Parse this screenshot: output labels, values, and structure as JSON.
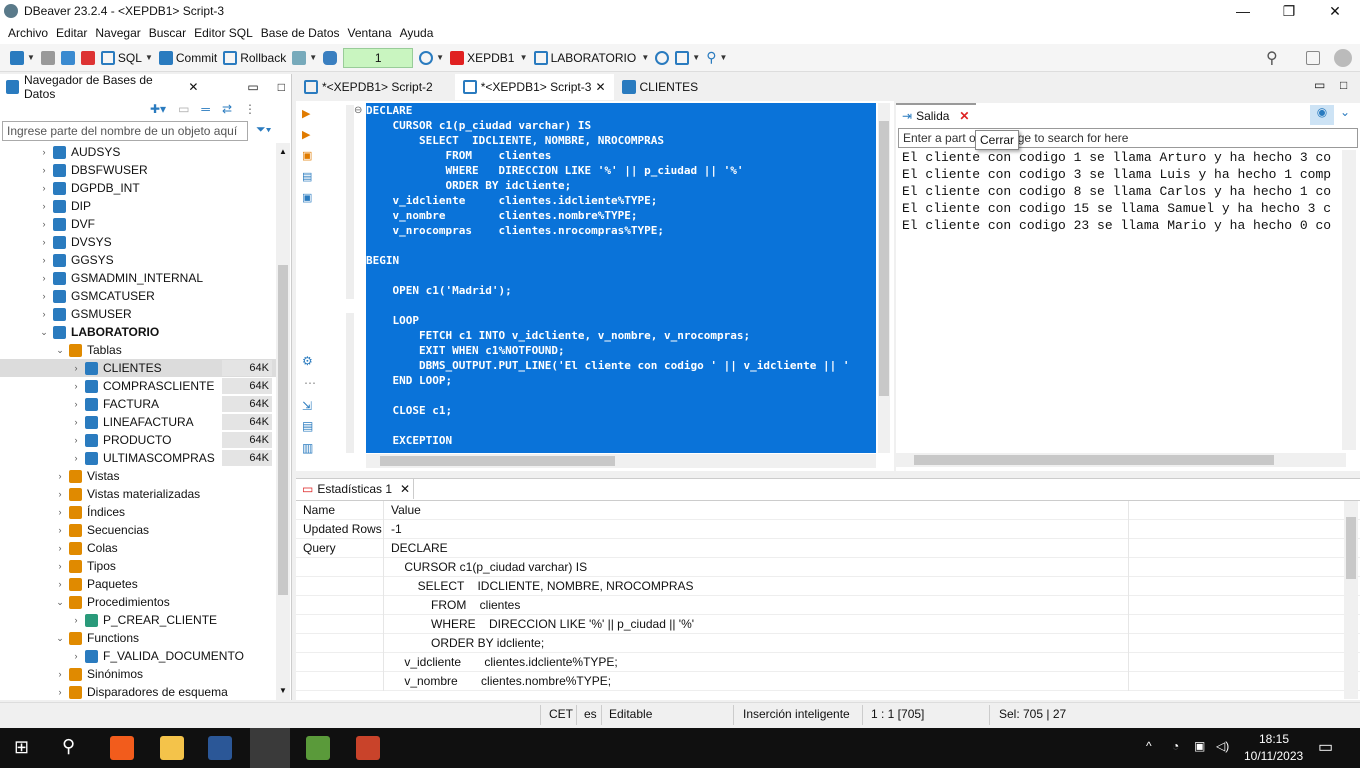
{
  "window": {
    "title": "DBeaver 23.2.4 - <XEPDB1> Script-3",
    "min": "—",
    "max": "❐",
    "close": "✕"
  },
  "menu": [
    "Archivo",
    "Editar",
    "Navegar",
    "Buscar",
    "Editor SQL",
    "Base de Datos",
    "Ventana",
    "Ayuda"
  ],
  "toolbar": {
    "sql": "SQL",
    "commit": "Commit",
    "rollback": "Rollback",
    "txn_count": "1",
    "datasource": "XEPDB1",
    "schema": "LABORATORIO"
  },
  "navigator": {
    "title": "Navegador de Bases de Datos",
    "filter_placeholder": "Ingrese parte del nombre de un objeto aquí",
    "items": [
      {
        "label": "AUDSYS",
        "depth": 1,
        "icon": "schema",
        "exp": ">"
      },
      {
        "label": "DBSFWUSER",
        "depth": 1,
        "icon": "schema",
        "exp": ">"
      },
      {
        "label": "DGPDB_INT",
        "depth": 1,
        "icon": "schema",
        "exp": ">"
      },
      {
        "label": "DIP",
        "depth": 1,
        "icon": "schema",
        "exp": ">"
      },
      {
        "label": "DVF",
        "depth": 1,
        "icon": "schema",
        "exp": ">"
      },
      {
        "label": "DVSYS",
        "depth": 1,
        "icon": "schema",
        "exp": ">"
      },
      {
        "label": "GGSYS",
        "depth": 1,
        "icon": "schema",
        "exp": ">"
      },
      {
        "label": "GSMADMIN_INTERNAL",
        "depth": 1,
        "icon": "schema",
        "exp": ">"
      },
      {
        "label": "GSMCATUSER",
        "depth": 1,
        "icon": "schema",
        "exp": ">"
      },
      {
        "label": "GSMUSER",
        "depth": 1,
        "icon": "schema",
        "exp": ">"
      },
      {
        "label": "LABORATORIO",
        "depth": 1,
        "icon": "schema",
        "exp": "v",
        "bold": true
      },
      {
        "label": "Tablas",
        "depth": 2,
        "icon": "tables",
        "exp": "v"
      },
      {
        "label": "CLIENTES",
        "depth": 3,
        "icon": "table",
        "exp": ">",
        "badge": "64K",
        "selected": true
      },
      {
        "label": "COMPRASCLIENTE",
        "depth": 3,
        "icon": "table",
        "exp": ">",
        "badge": "64K"
      },
      {
        "label": "FACTURA",
        "depth": 3,
        "icon": "table",
        "exp": ">",
        "badge": "64K"
      },
      {
        "label": "LINEAFACTURA",
        "depth": 3,
        "icon": "table",
        "exp": ">",
        "badge": "64K"
      },
      {
        "label": "PRODUCTO",
        "depth": 3,
        "icon": "table",
        "exp": ">",
        "badge": "64K"
      },
      {
        "label": "ULTIMASCOMPRAS",
        "depth": 3,
        "icon": "table",
        "exp": ">",
        "badge": "64K"
      },
      {
        "label": "Vistas",
        "depth": 2,
        "icon": "view",
        "exp": ">"
      },
      {
        "label": "Vistas materializadas",
        "depth": 2,
        "icon": "view",
        "exp": ">"
      },
      {
        "label": "Índices",
        "depth": 2,
        "icon": "folder",
        "exp": ">"
      },
      {
        "label": "Secuencias",
        "depth": 2,
        "icon": "folder",
        "exp": ">"
      },
      {
        "label": "Colas",
        "depth": 2,
        "icon": "folder",
        "exp": ">"
      },
      {
        "label": "Tipos",
        "depth": 2,
        "icon": "folder",
        "exp": ">"
      },
      {
        "label": "Paquetes",
        "depth": 2,
        "icon": "folder",
        "exp": ">"
      },
      {
        "label": "Procedimientos",
        "depth": 2,
        "icon": "folder",
        "exp": "v"
      },
      {
        "label": "P_CREAR_CLIENTE",
        "depth": 3,
        "icon": "procedure",
        "exp": ">"
      },
      {
        "label": "Functions",
        "depth": 2,
        "icon": "folder",
        "exp": "v"
      },
      {
        "label": "F_VALIDA_DOCUMENTO",
        "depth": 3,
        "icon": "function",
        "exp": ">"
      },
      {
        "label": "Sinónimos",
        "depth": 2,
        "icon": "folder",
        "exp": ">"
      },
      {
        "label": "Disparadores de esquema",
        "depth": 2,
        "icon": "folder",
        "exp": ">"
      }
    ]
  },
  "editor_tabs": [
    {
      "label": "*<XEPDB1> Script-2"
    },
    {
      "label": "*<XEPDB1> Script-3",
      "active": true,
      "close": "✕"
    },
    {
      "label": "CLIENTES"
    }
  ],
  "code": [
    "DECLARE",
    "    CURSOR c1(p_ciudad varchar) IS",
    "        SELECT  IDCLIENTE, NOMBRE, NROCOMPRAS",
    "            FROM    clientes",
    "            WHERE   DIRECCION LIKE '%' || p_ciudad || '%'",
    "            ORDER BY idcliente;",
    "    v_idcliente     clientes.idcliente%TYPE;",
    "    v_nombre        clientes.nombre%TYPE;",
    "    v_nrocompras    clientes.nrocompras%TYPE;",
    "",
    "BEGIN",
    "",
    "    OPEN c1('Madrid');",
    "",
    "    LOOP",
    "        FETCH c1 INTO v_idcliente, v_nombre, v_nrocompras;",
    "        EXIT WHEN c1%NOTFOUND;",
    "        DBMS_OUTPUT.PUT_LINE('El cliente con codigo ' || v_idcliente || '",
    "    END LOOP;",
    "",
    "    CLOSE c1;",
    "",
    "    EXCEPTION"
  ],
  "output": {
    "tab": "Salida",
    "search_placeholder": "Enter a part of message to search for here",
    "tooltip": "Cerrar",
    "lines": [
      "El cliente con codigo 1 se llama Arturo y ha hecho 3 co",
      "El cliente con codigo 3 se llama Luis y ha hecho 1 comp",
      "El cliente con codigo 8 se llama Carlos y ha hecho 1 co",
      "El cliente con codigo 15 se llama Samuel y ha hecho 3 c",
      "El cliente con codigo 23 se llama Mario y ha hecho 0 co"
    ]
  },
  "stats": {
    "tab": "Estadísticas 1",
    "headers": [
      "Name",
      "Value"
    ],
    "rows": [
      [
        "Updated Rows",
        "-1"
      ],
      [
        "Query",
        "DECLARE"
      ],
      [
        "",
        "    CURSOR c1(p_ciudad varchar) IS"
      ],
      [
        "",
        "        SELECT    IDCLIENTE, NOMBRE, NROCOMPRAS"
      ],
      [
        "",
        "            FROM    clientes"
      ],
      [
        "",
        "            WHERE    DIRECCION LIKE '%' || p_ciudad || '%'"
      ],
      [
        "",
        "            ORDER BY idcliente;"
      ],
      [
        "",
        "    v_idcliente       clientes.idcliente%TYPE;"
      ],
      [
        "",
        "    v_nombre       clientes.nombre%TYPE;"
      ]
    ]
  },
  "status": {
    "tz": "CET",
    "lang": "es",
    "mode": "Editable",
    "insert": "Inserción inteligente",
    "pos": "1 : 1 [705]",
    "sel": "Sel: 705 | 27"
  },
  "taskbar": {
    "time": "18:15",
    "date": "10/11/2023"
  }
}
